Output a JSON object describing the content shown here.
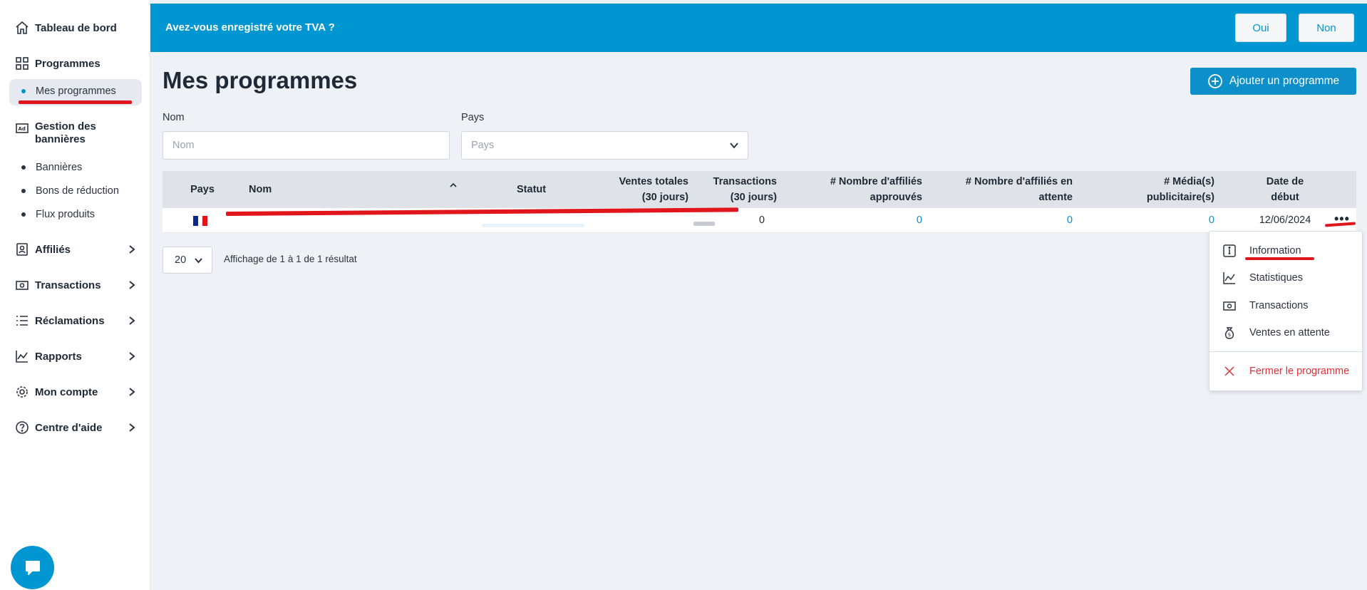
{
  "sidebar": {
    "dashboard": "Tableau de bord",
    "programmes": "Programmes",
    "mes_programmes": "Mes programmes",
    "banners_group": "Gestion des bannières",
    "banners_line1": "Gestion des",
    "banners_line2": "bannières",
    "bannieres": "Bannières",
    "bons": "Bons de réduction",
    "flux": "Flux produits",
    "affilies": "Affiliés",
    "transactions": "Transactions",
    "reclamations": "Réclamations",
    "rapports": "Rapports",
    "compte": "Mon compte",
    "aide": "Centre d'aide"
  },
  "banner": {
    "question": "Avez-vous enregistré votre TVA ?",
    "yes": "Oui",
    "no": "Non"
  },
  "page": {
    "title": "Mes programmes",
    "add_button": "Ajouter un programme"
  },
  "filters": {
    "name_label": "Nom",
    "name_placeholder": "Nom",
    "country_label": "Pays",
    "country_placeholder": "Pays"
  },
  "table": {
    "headers": {
      "pays": "Pays",
      "nom": "Nom",
      "statut": "Statut",
      "ventes_1": "Ventes totales",
      "ventes_2": "(30 jours)",
      "trans_1": "Transactions",
      "trans_2": "(30 jours)",
      "approuves_1": "# Nombre d'affiliés",
      "approuves_2": "approuvés",
      "attente_1": "# Nombre d'affiliés en",
      "attente_2": "attente",
      "media_1": "# Média(s)",
      "media_2": "publicitaire(s)",
      "date_1": "Date de",
      "date_2": "début"
    },
    "rows": [
      {
        "country_flag": "FR",
        "transactions": "0",
        "approuves": "0",
        "attente": "0",
        "media": "0",
        "date": "12/06/2024"
      }
    ]
  },
  "pagination": {
    "per_page": "20",
    "summary": "Affichage de 1 à 1 de 1 résultat"
  },
  "row_menu": {
    "information": "Information",
    "statistiques": "Statistiques",
    "transactions": "Transactions",
    "ventes_attente": "Ventes en attente",
    "fermer": "Fermer le programme"
  },
  "colors": {
    "accent": "#0096d1",
    "danger": "#e0303a",
    "annotation_red": "#e0161c"
  }
}
